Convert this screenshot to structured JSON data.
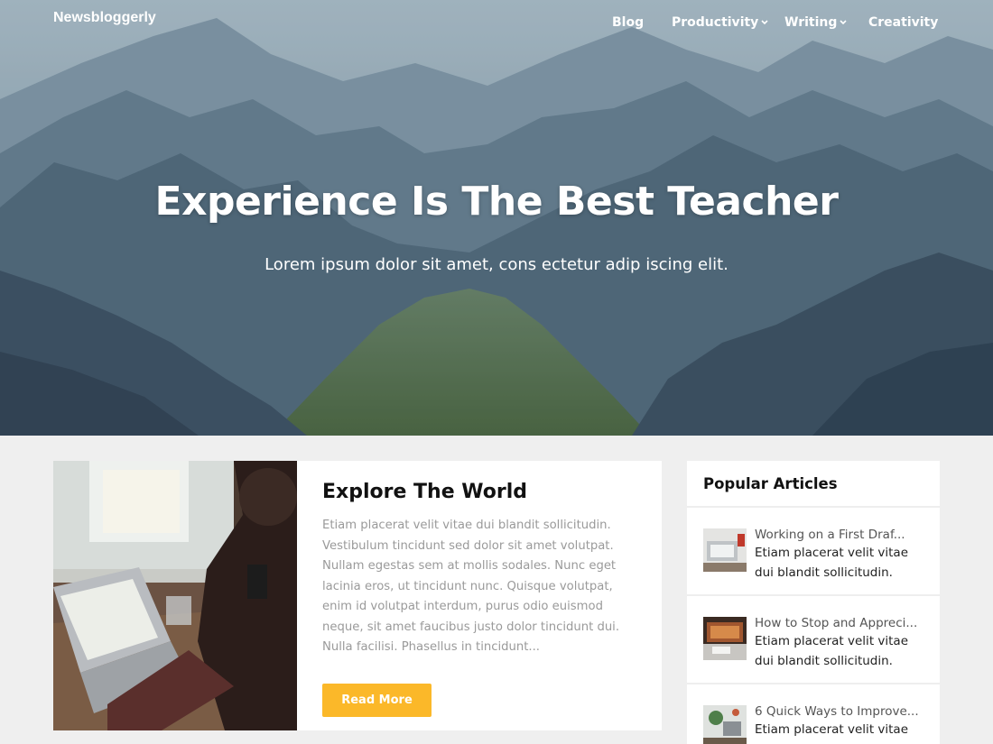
{
  "site": {
    "brand": "Newsbloggerly"
  },
  "nav": {
    "items": [
      {
        "label": "Blog",
        "has_dropdown": false
      },
      {
        "label": "Productivity",
        "has_dropdown": true
      },
      {
        "label": "Writing",
        "has_dropdown": true
      },
      {
        "label": "Creativity",
        "has_dropdown": false
      }
    ]
  },
  "hero": {
    "title": "Experience Is The Best Teacher",
    "subtitle": "Lorem ipsum dolor sit amet, cons ectetur adip iscing elit."
  },
  "post": {
    "title": "Explore The World",
    "excerpt": "Etiam placerat velit vitae dui blandit sollicitudin. Vestibulum tincidunt sed dolor sit amet volutpat. Nullam egestas sem at mollis sodales. Nunc eget lacinia eros, ut tincidunt nunc. Quisque volutpat, enim id volutpat interdum, purus odio euismod neque, sit amet faucibus justo dolor tincidunt dui. Nulla facilisi. Phasellus in tincidunt...",
    "button_label": "Read More"
  },
  "sidebar": {
    "title": "Popular Articles",
    "articles": [
      {
        "title": "Working on a First Draf...",
        "desc": "Etiam placerat velit vitae dui blandit sollicitudin."
      },
      {
        "title": "How to Stop and Appreci...",
        "desc": "Etiam placerat velit vitae dui blandit sollicitudin."
      },
      {
        "title": "6 Quick Ways to Improve...",
        "desc": "Etiam placerat velit vitae dui blandit sollicitudin."
      }
    ]
  },
  "colors": {
    "accent": "#fbb829",
    "background": "#efefef",
    "text_muted": "#9a9a9a"
  }
}
